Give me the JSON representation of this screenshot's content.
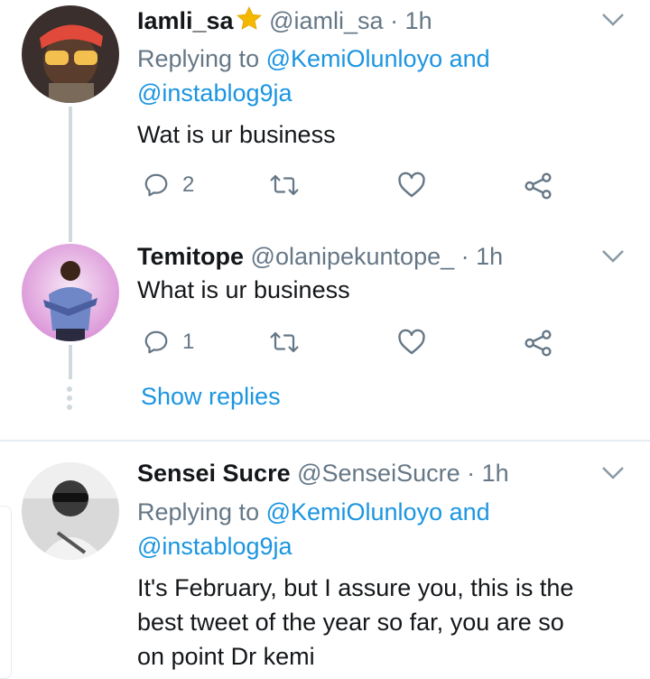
{
  "tweets": [
    {
      "name": "Iamli_sa",
      "handle": "@iamli_sa",
      "time": "· 1h",
      "replying_prefix": "Replying to ",
      "replying_users": [
        "@KemiOlunloyo",
        "@instablog9ja"
      ],
      "replying_joiner": " and",
      "text": "Wat is ur business",
      "reply_count": "2"
    },
    {
      "name": "Temitope",
      "handle": "@olanipekuntope_",
      "time": "· 1h",
      "text": "What is ur business",
      "reply_count": "1"
    },
    {
      "name": "Sensei Sucre",
      "handle": "@SenseiSucre",
      "time": "· 1h",
      "replying_prefix": "Replying to ",
      "replying_users": [
        "@KemiOlunloyo",
        "@instablog9ja"
      ],
      "replying_joiner": " and",
      "text_lines": [
        "It's February, but I assure you, this is the",
        "best tweet of the year so far, you are so",
        "on point Dr kemi"
      ]
    }
  ],
  "show_replies": "Show replies",
  "icons": {
    "verified_star": "star-emoji-icon",
    "reply": "reply-icon",
    "retweet": "retweet-icon",
    "like": "heart-icon",
    "share": "share-icon",
    "caret": "chevron-down-icon"
  },
  "colors": {
    "link": "#1b95e0",
    "muted": "#657786",
    "text": "#14171a",
    "star": "#f5b800"
  }
}
